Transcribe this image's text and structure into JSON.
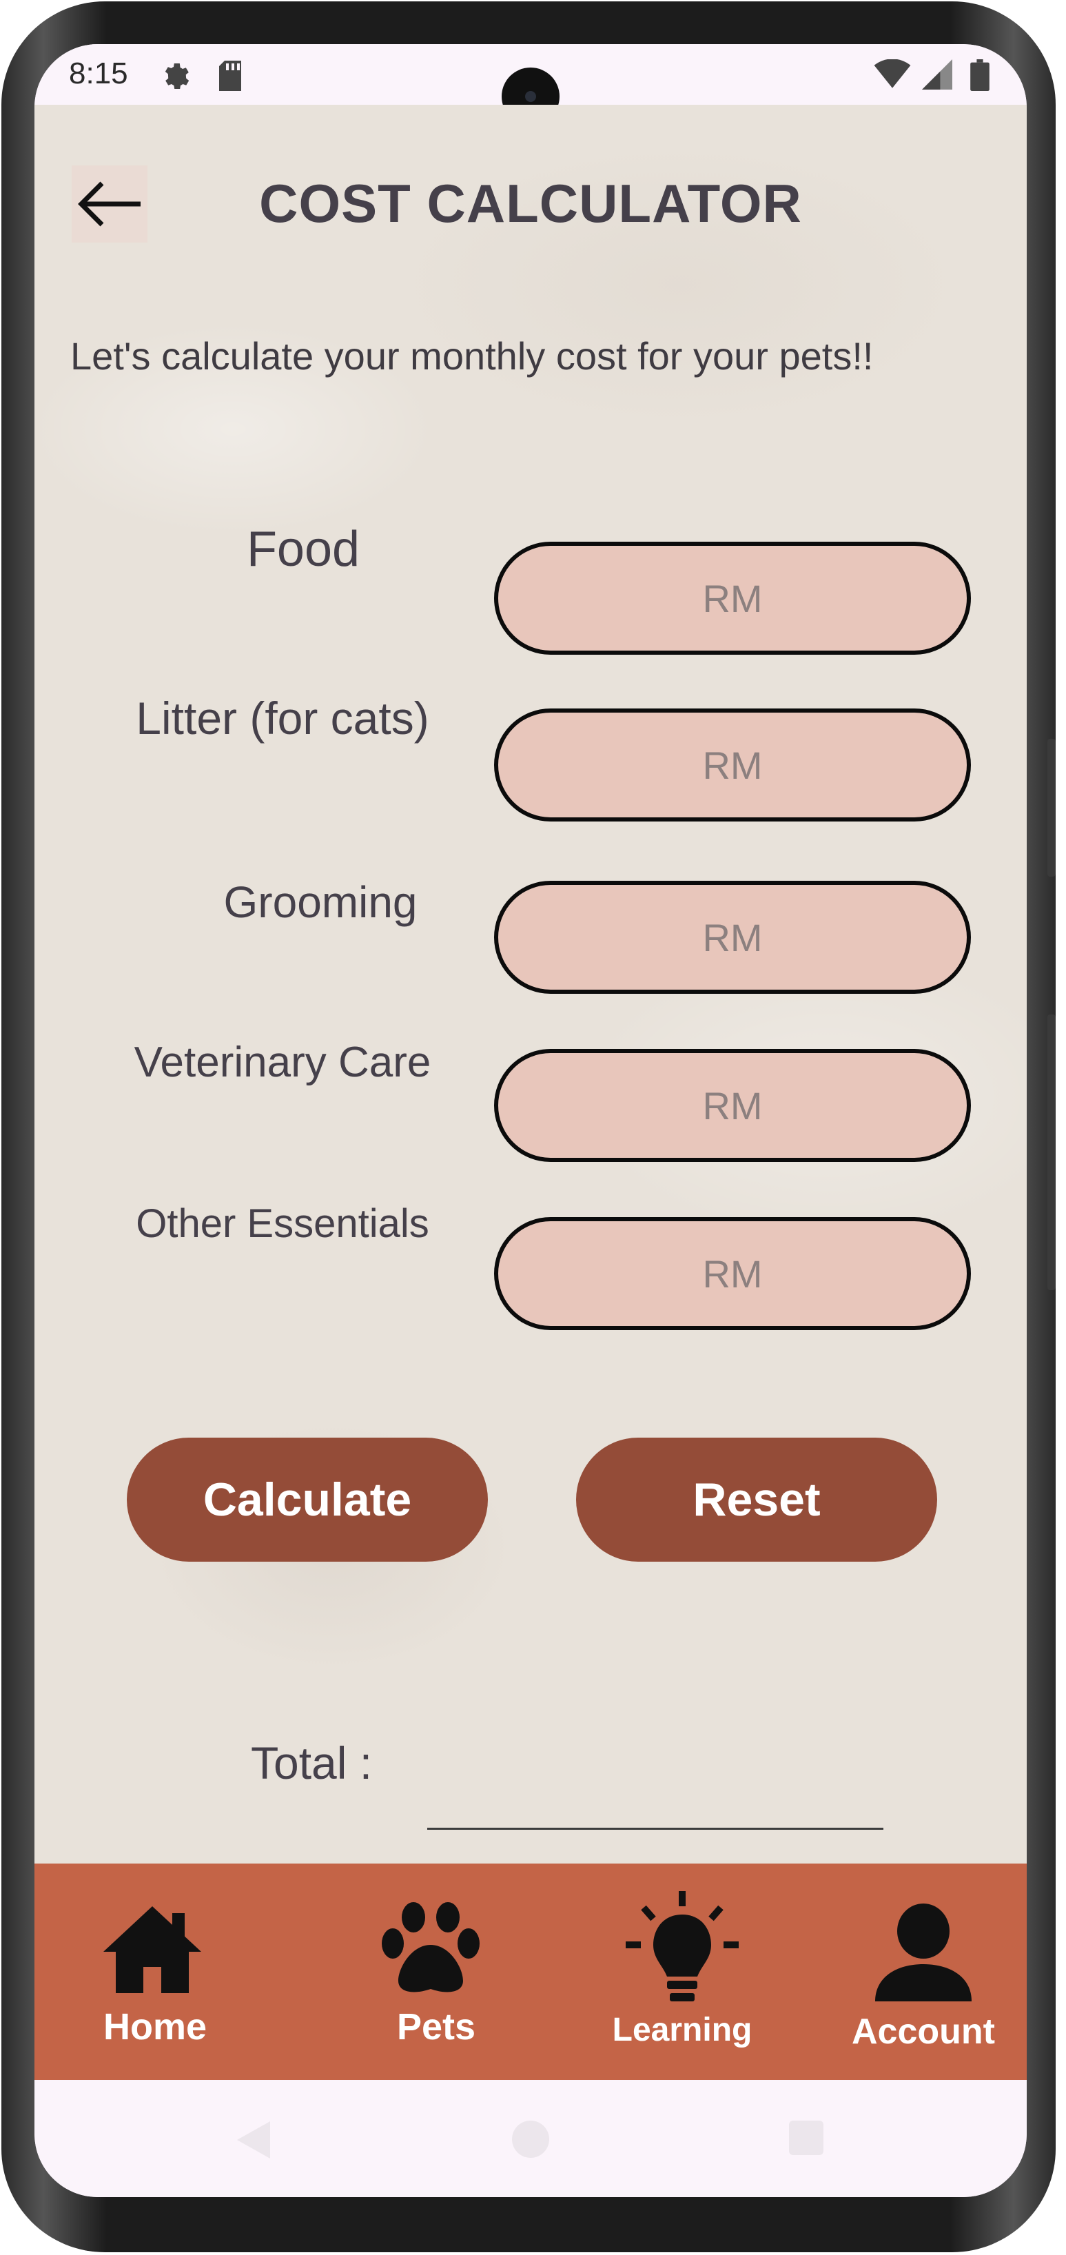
{
  "status_bar": {
    "time": "8:15",
    "left_icons": [
      "gear-icon",
      "sd-card-icon"
    ],
    "right_icons": [
      "wifi-icon",
      "signal-icon",
      "battery-icon"
    ]
  },
  "header": {
    "back_icon": "arrow-left-icon",
    "title": "COST CALCULATOR"
  },
  "intro_text": "Let's calculate your monthly cost for your pets!!",
  "fields": [
    {
      "label": "Food",
      "placeholder": "RM"
    },
    {
      "label": "Litter (for cats)",
      "placeholder": "RM"
    },
    {
      "label": "Grooming",
      "placeholder": "RM"
    },
    {
      "label": "Veterinary Care",
      "placeholder": "RM"
    },
    {
      "label": "Other Essentials",
      "placeholder": "RM"
    }
  ],
  "buttons": {
    "calculate": "Calculate",
    "reset": "Reset"
  },
  "total": {
    "label": "Total  :",
    "value": ""
  },
  "bottom_nav": [
    {
      "label": "Home",
      "icon": "home-icon"
    },
    {
      "label": "Pets",
      "icon": "paw-icon"
    },
    {
      "label": "Learning",
      "icon": "lightbulb-icon"
    },
    {
      "label": "Account",
      "icon": "user-icon"
    }
  ],
  "colors": {
    "background": "#e8e2da",
    "field_fill": "#e8c6bb",
    "button": "#944c38",
    "nav_bar": "#c46447",
    "title_text": "#45404a"
  }
}
